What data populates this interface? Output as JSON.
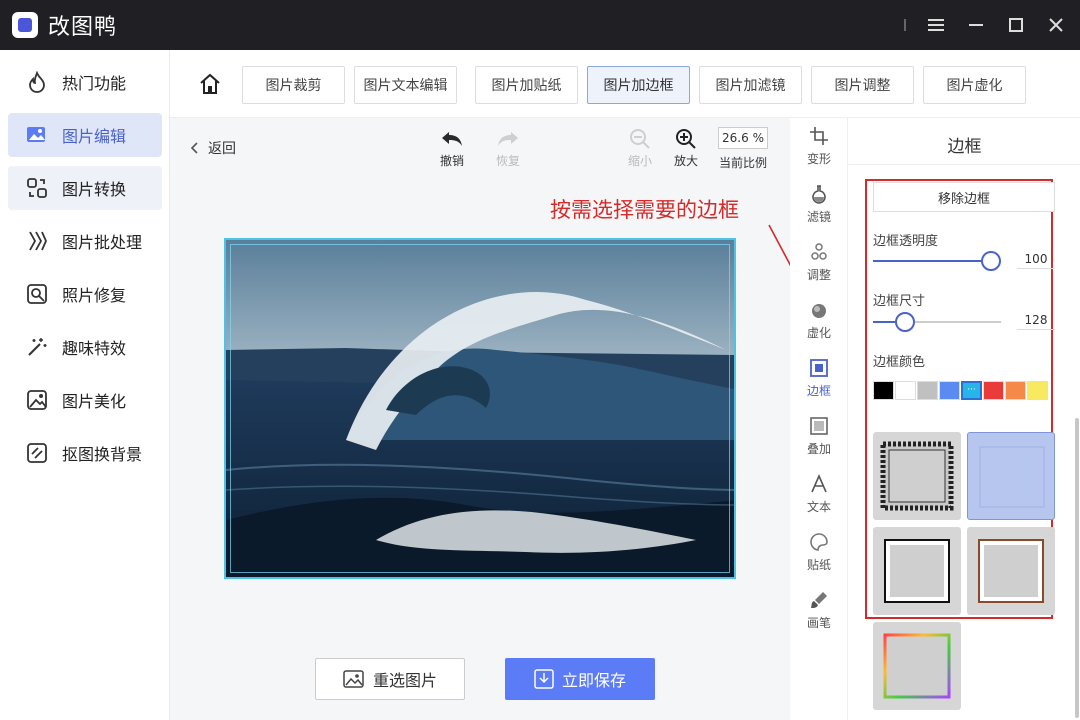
{
  "app": {
    "title": "改图鸭"
  },
  "sidebar": {
    "items": [
      {
        "label": "热门功能",
        "icon": "flame-icon"
      },
      {
        "label": "图片编辑",
        "icon": "image-edit-icon"
      },
      {
        "label": "图片转换",
        "icon": "convert-icon"
      },
      {
        "label": "图片批处理",
        "icon": "batch-icon"
      },
      {
        "label": "照片修复",
        "icon": "repair-icon"
      },
      {
        "label": "趣味特效",
        "icon": "magic-wand-icon"
      },
      {
        "label": "图片美化",
        "icon": "beautify-icon"
      },
      {
        "label": "抠图换背景",
        "icon": "cutout-icon"
      }
    ],
    "active_index": 1
  },
  "tabs": [
    "图片裁剪",
    "图片文本编辑",
    "图片加贴纸",
    "图片加边框",
    "图片加滤镜",
    "图片调整",
    "图片虚化"
  ],
  "active_tab": "图片加边框",
  "editor": {
    "back_label": "返回",
    "undo_label": "撤销",
    "redo_label": "恢复",
    "zoom_out_label": "缩小",
    "zoom_in_label": "放大",
    "zoom_value": "26.6 %",
    "zoom_caption": "当前比例",
    "annotation": "按需选择需要的边框",
    "reselect_label": "重选图片",
    "save_label": "立即保存"
  },
  "vertical_tools": [
    {
      "label": "变形",
      "icon": "crop-icon"
    },
    {
      "label": "滤镜",
      "icon": "flask-icon"
    },
    {
      "label": "调整",
      "icon": "adjust-icon"
    },
    {
      "label": "虚化",
      "icon": "blur-icon"
    },
    {
      "label": "边框",
      "icon": "frame-icon"
    },
    {
      "label": "叠加",
      "icon": "overlay-icon"
    },
    {
      "label": "文本",
      "icon": "text-icon"
    },
    {
      "label": "贴纸",
      "icon": "sticker-icon"
    },
    {
      "label": "画笔",
      "icon": "brush-icon"
    }
  ],
  "active_vertical_tool": "边框",
  "panel": {
    "title": "边框",
    "remove_label": "移除边框",
    "opacity_label": "边框透明度",
    "opacity_value": "100",
    "size_label": "边框尺寸",
    "size_value": "128",
    "color_label": "边框颜色",
    "colors": [
      "#000000",
      "#ffffff",
      "#c0c0c0",
      "#5b8af0",
      "#27b4e8",
      "#ea3b3b",
      "#f5894a",
      "#f7ea5e"
    ],
    "selected_color": "#27b4e8",
    "color_more_glyph": "···"
  },
  "colors": {
    "titlebar": "#202024",
    "accent": "#5b7cf6",
    "annotation": "#d42a2a"
  }
}
